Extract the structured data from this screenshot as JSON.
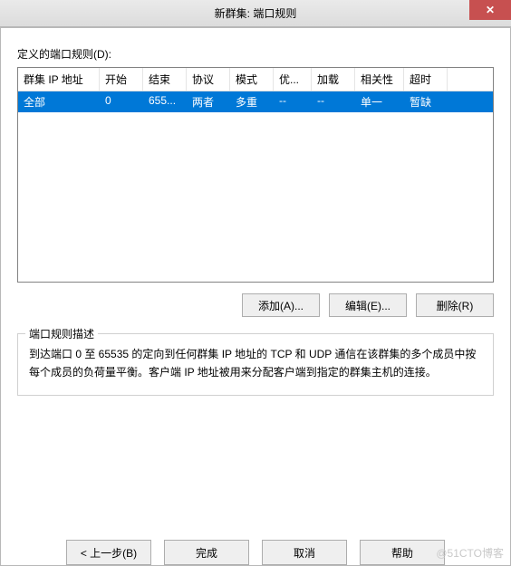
{
  "window": {
    "title": "新群集: 端口规则",
    "close_glyph": "✕"
  },
  "section": {
    "label": "定义的端口规则(D):"
  },
  "table": {
    "headers": [
      "群集 IP 地址",
      "开始",
      "结束",
      "协议",
      "模式",
      "优...",
      "加载",
      "相关性",
      "超时"
    ],
    "rows": [
      {
        "cells": [
          "全部",
          "0",
          "655...",
          "两者",
          "多重",
          "--",
          "--",
          "单一",
          "暂缺"
        ]
      }
    ]
  },
  "buttons": {
    "add": "添加(A)...",
    "edit": "编辑(E)...",
    "remove": "删除(R)"
  },
  "description": {
    "legend": "端口规则描述",
    "text": "到达端口 0 至 65535 的定向到任何群集 IP 地址的 TCP 和 UDP 通信在该群集的多个成员中按每个成员的负荷量平衡。客户端 IP 地址被用来分配客户端到指定的群集主机的连接。"
  },
  "wizard": {
    "back": "< 上一步(B)",
    "finish": "完成",
    "cancel": "取消",
    "help": "帮助"
  },
  "watermark": "@51CTO博客"
}
